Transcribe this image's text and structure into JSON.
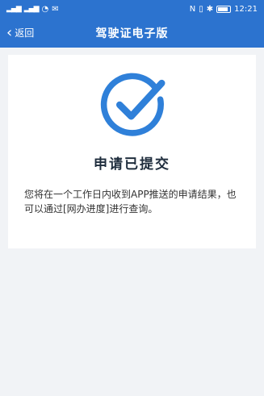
{
  "status_bar": {
    "left_icons": [
      "signal-icon",
      "signal-icon",
      "wifi-icon",
      "message-icon"
    ],
    "right_icons": [
      "nfc-icon",
      "vibrate-icon",
      "bluetooth-icon",
      "battery-icon"
    ],
    "time": "12:21"
  },
  "nav": {
    "back_label": "返回",
    "title": "驾驶证电子版"
  },
  "result": {
    "title": "申请已提交",
    "description": "您将在一个工作日内收到APP推送的申请结果，也可以通过[网办进度]进行查询。"
  },
  "colors": {
    "primary": "#2c73cf",
    "check": "#2f80d9",
    "background": "#f1f3f6"
  }
}
